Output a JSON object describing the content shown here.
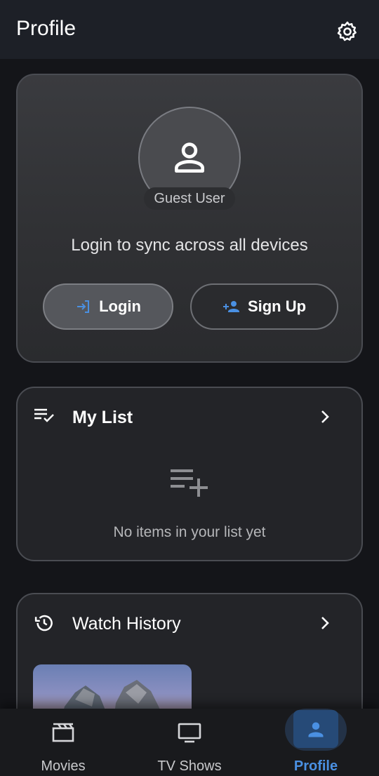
{
  "header": {
    "title": "Profile",
    "settings_icon": "gear-icon"
  },
  "profile": {
    "avatar_icon": "person-icon",
    "user_label": "Guest User",
    "sync_message": "Login to sync across all devices",
    "login_label": "Login",
    "signup_label": "Sign Up"
  },
  "my_list": {
    "title": "My List",
    "empty_message": "No items in your list yet"
  },
  "watch_history": {
    "title": "Watch History"
  },
  "bottom_nav": {
    "items": [
      {
        "label": "Movies",
        "icon": "clapperboard-icon"
      },
      {
        "label": "TV Shows",
        "icon": "tv-icon"
      },
      {
        "label": "Profile",
        "icon": "person-icon",
        "active": true
      }
    ]
  },
  "colors": {
    "accent": "#4a90e2",
    "background": "#141519"
  }
}
